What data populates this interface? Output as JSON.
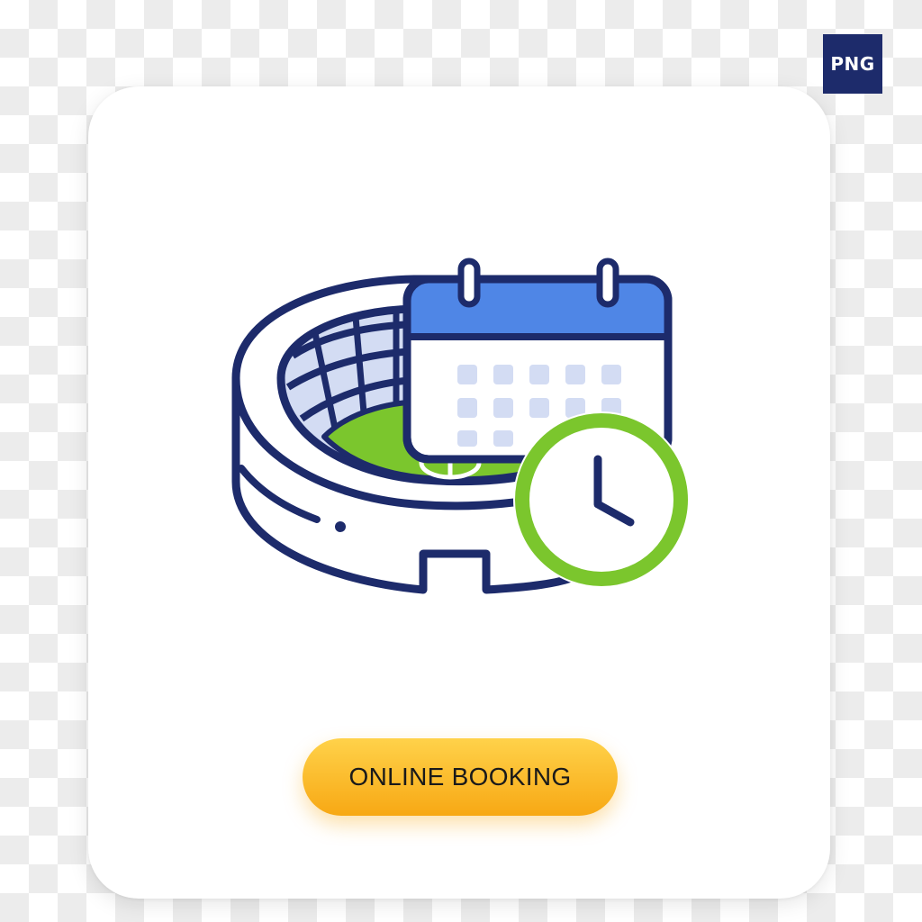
{
  "badge": {
    "label": "PNG"
  },
  "icon": {
    "name": "stadium-booking-icon",
    "parts": [
      "stadium-icon",
      "calendar-icon",
      "clock-icon"
    ]
  },
  "cta": {
    "label": "ONLINE BOOKING"
  },
  "colors": {
    "navy": "#1d2b6b",
    "blue": "#4f86e6",
    "light_blue": "#d3dcf3",
    "green": "#7bc62d",
    "yellow_top": "#ffd24a",
    "yellow_bottom": "#f7a814"
  }
}
